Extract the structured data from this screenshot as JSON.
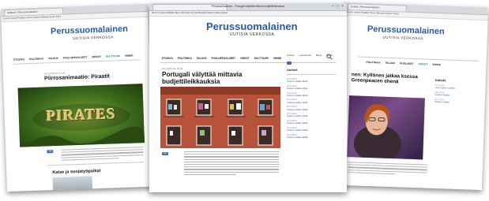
{
  "screens": {
    "left": {
      "window_title": "Kulttuuri | Perussuomalainen",
      "bookmarks": "Etusivu   Uutiset   Politiikka   Talous   Kulttuuri   Mielipide   Blogit   Videot",
      "logo": "Perussuomalainen",
      "tagline": "UUTISIA VERKOSSA",
      "nav": [
        "ETUSIVU",
        "POLITIIKKA",
        "TALOUS",
        "PUOLUEPUOLUEET",
        "VIDEOT",
        "KULTTUURI",
        "VIIHDE"
      ],
      "date": "15.3.2013  klo 14.20",
      "headline": "Piirrosanimaatio: Piraatit",
      "image_text": "PIRATES",
      "share": "Jaa",
      "second_headline": "Katse ja suojatyöpaikat"
    },
    "center": {
      "window_title": "Perussuomalainen - Portugali välyttää mittavia budjettileikkauksia",
      "bookmarks": "Etusivu   Uutiset   Politiikka   Talous   Ulkomaat   Kotimaa   Mielipide   Kulttuuri   Videot   Arkisto",
      "logo": "Perussuomalainen",
      "tagline": "UUTISIA VERKOSSA",
      "nav": [
        "ETUSIVU",
        "POLITIIKKA",
        "TALOUS",
        "PUOLUEPUOLUEET",
        "VIDEOT",
        "KULTTUURI",
        "VIIHDE"
      ],
      "date": "15.3.2013  klo 10.05",
      "headline": "Portugali välyttää mittavia budjettileikkauksia",
      "share": "Jaa",
      "sidebar_tabs": [
        "Uutiset",
        "Luetuimmat",
        "Blogit",
        "Kuvat"
      ],
      "sidebar_title": "Uutiset"
    },
    "right": {
      "window_title": "Uutiset | Perussuomalainen",
      "bookmarks": "Etusivu   Uutiset   Politiikka   Talous   Ulkomaat   Kulttuuri   Videot",
      "logo": "Perussuomalainen",
      "tagline": "UUTISIA VERKOSSA",
      "nav": [
        "POLITIIKKA",
        "TALOUS",
        "PUOLUEET",
        "VIDEOT",
        "VIIHDE"
      ],
      "headline": "nen: Kyllönen jatkaa ksessa Greenpeacen ehenä",
      "sidebar_title": "Uutiset"
    }
  },
  "colors": {
    "logo_blue": "#2659a6",
    "nav_highlight": "#2c8a3c",
    "pirates_green": "#3d6b1c"
  }
}
